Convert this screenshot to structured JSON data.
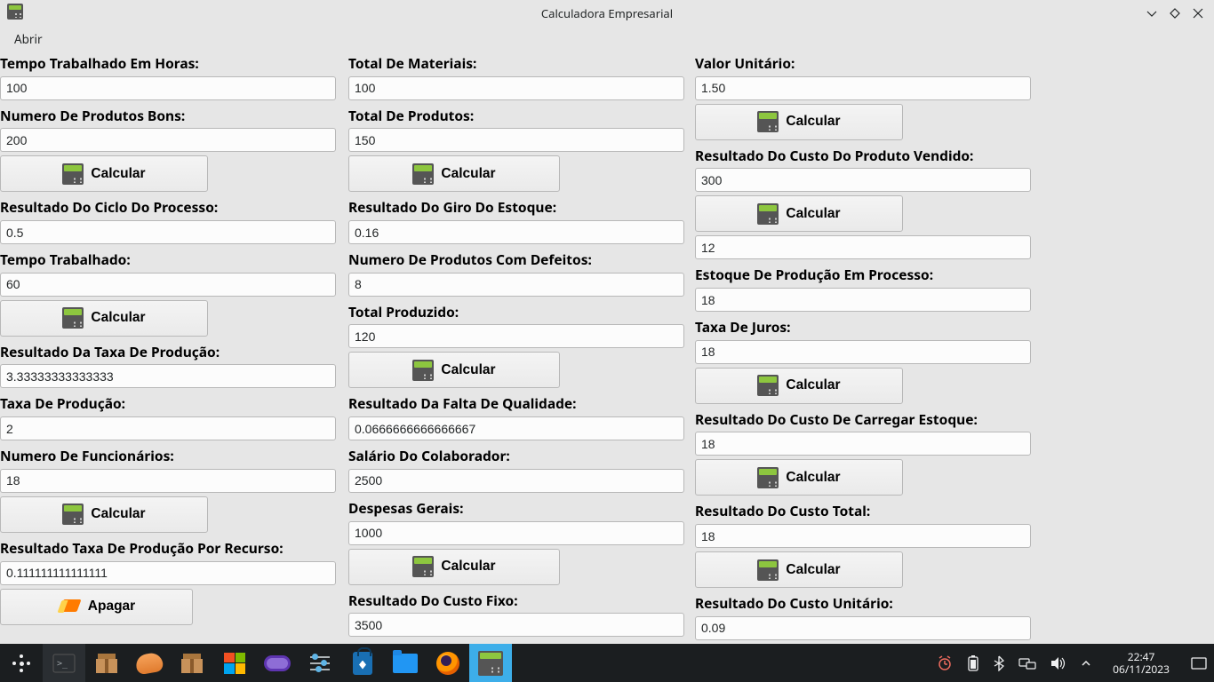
{
  "window": {
    "title": "Calculadora Empresarial"
  },
  "menu": {
    "abrir": "Abrir"
  },
  "buttons": {
    "calcular": "Calcular",
    "apagar": "Apagar"
  },
  "col1": {
    "tempo_trab_horas_label": "Tempo Trabalhado Em Horas:",
    "tempo_trab_horas_value": "100",
    "num_produtos_bons_label": "Numero De Produtos Bons:",
    "num_produtos_bons_value": "200",
    "res_ciclo_proc_label": "Resultado Do Ciclo Do Processo:",
    "res_ciclo_proc_value": "0.5",
    "tempo_trab_label": "Tempo Trabalhado:",
    "tempo_trab_value": "60",
    "res_taxa_prod_label": "Resultado Da Taxa De Produção:",
    "res_taxa_prod_value": "3.33333333333333",
    "taxa_prod_label": "Taxa De Produção:",
    "taxa_prod_value": "2",
    "num_func_label": "Numero De Funcionários:",
    "num_func_value": "18",
    "res_taxa_prod_recurso_label": "Resultado Taxa  De Produção Por Recurso:",
    "res_taxa_prod_recurso_value": "0.111111111111111"
  },
  "col2": {
    "total_materiais_label": "Total De Materiais:",
    "total_materiais_value": "100",
    "total_produtos_label": "Total De Produtos:",
    "total_produtos_value": "150",
    "res_giro_estoque_label": "Resultado Do Giro Do Estoque:",
    "res_giro_estoque_value": "0.16",
    "num_prod_defeitos_label": "Numero De Produtos Com Defeitos:",
    "num_prod_defeitos_value": "8",
    "total_produzido_label": "Total Produzido:",
    "total_produzido_value": "120",
    "res_falta_qualidade_label": "Resultado Da Falta De Qualidade:",
    "res_falta_qualidade_value": "0.0666666666666667",
    "salario_colab_label": "Salário Do Colaborador:",
    "salario_colab_value": "2500",
    "despesas_gerais_label": "Despesas Gerais:",
    "despesas_gerais_value": "1000",
    "res_custo_fixo_label": "Resultado Do Custo Fixo:",
    "res_custo_fixo_value": "3500"
  },
  "col3": {
    "valor_unitario_label": "Valor Unitário:",
    "valor_unitario_value": "1.50",
    "res_custo_prod_vendido_label": "Resultado Do Custo Do Produto Vendido:",
    "res_custo_prod_vendido_value": "300",
    "unnamed_value": "12",
    "estoque_prod_proc_label": "Estoque De Produção Em Processo:",
    "estoque_prod_proc_value": "18",
    "taxa_juros_label": "Taxa De Juros:",
    "taxa_juros_value": "18",
    "res_custo_carregar_label": "Resultado Do Custo De Carregar Estoque:",
    "res_custo_carregar_value": "18",
    "res_custo_total_label": "Resultado Do Custo Total:",
    "res_custo_total_value": "18",
    "res_custo_unit_label": "Resultado Do Custo Unitário:",
    "res_custo_unit_value": "0.09"
  },
  "taskbar": {
    "time": "22:47",
    "date": "06/11/2023"
  }
}
